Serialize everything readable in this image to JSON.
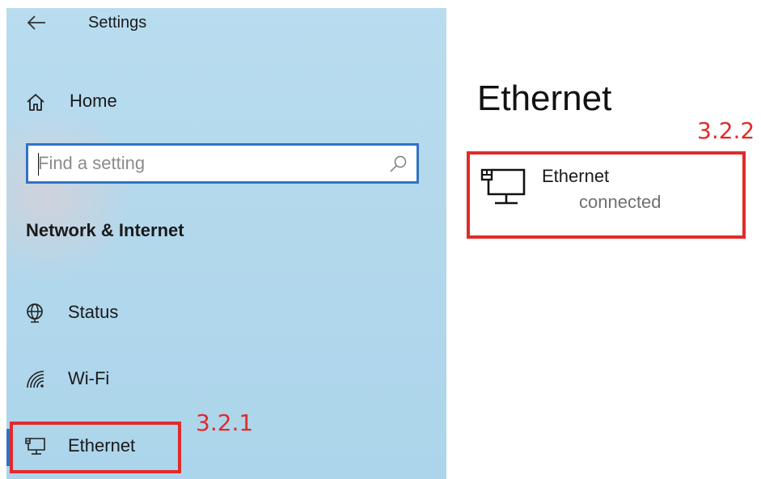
{
  "window": {
    "title": "Settings"
  },
  "sidebar": {
    "home_label": "Home",
    "search": {
      "placeholder": "Find a setting",
      "value": ""
    },
    "section_heading": "Network & Internet",
    "items": [
      {
        "label": "Status",
        "icon": "globe-icon"
      },
      {
        "label": "Wi-Fi",
        "icon": "wifi-icon"
      },
      {
        "label": "Ethernet",
        "icon": "ethernet-icon",
        "selected": true
      }
    ]
  },
  "main": {
    "heading": "Ethernet",
    "connection": {
      "name": "Ethernet",
      "status": "connected",
      "icon": "ethernet-icon"
    }
  },
  "annotations": {
    "sidebar_callout": "3.2.1",
    "card_callout": "3.2.2",
    "color": "#e02b2b"
  },
  "colors": {
    "accent": "#2f73c6",
    "sidebar_background": "#b3d8ec"
  }
}
